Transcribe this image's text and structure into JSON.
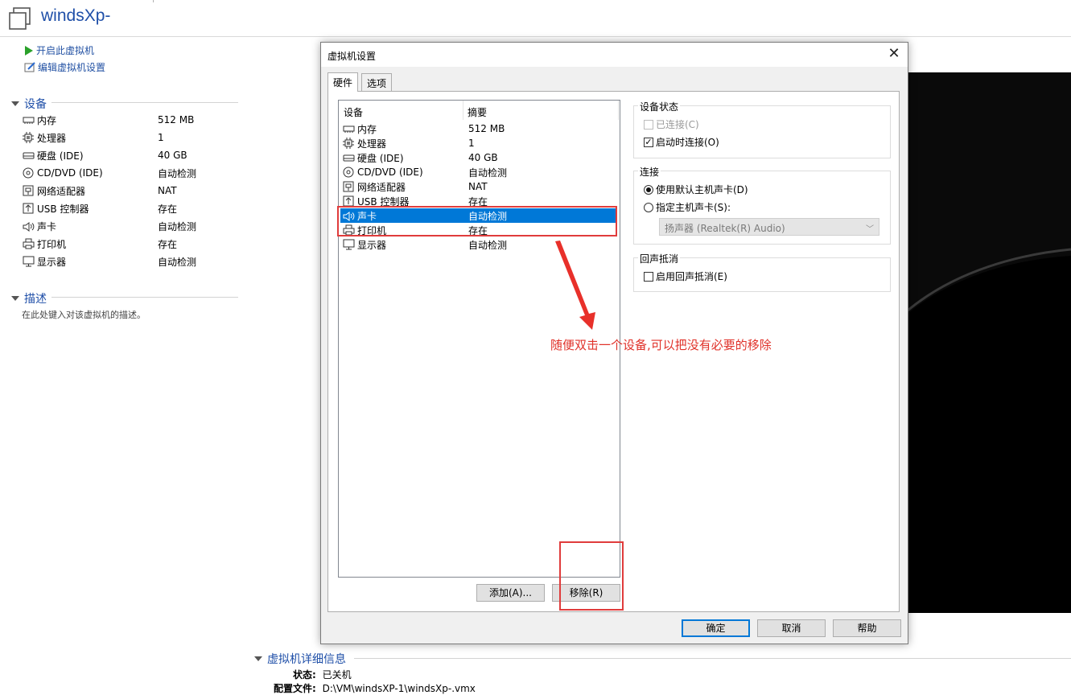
{
  "window": {
    "title": "windsXp-"
  },
  "actions": {
    "power_on": "开启此虚拟机",
    "edit_settings": "编辑虚拟机设置"
  },
  "devices_section": {
    "title": "设备",
    "items": [
      {
        "icon": "memory-icon",
        "name": "内存",
        "value": "512 MB"
      },
      {
        "icon": "cpu-icon",
        "name": "处理器",
        "value": "1"
      },
      {
        "icon": "harddisk-icon",
        "name": "硬盘 (IDE)",
        "value": "40 GB"
      },
      {
        "icon": "cd-icon",
        "name": "CD/DVD (IDE)",
        "value": "自动检测"
      },
      {
        "icon": "network-icon",
        "name": "网络适配器",
        "value": "NAT"
      },
      {
        "icon": "usb-icon",
        "name": "USB 控制器",
        "value": "存在"
      },
      {
        "icon": "speaker-icon",
        "name": "声卡",
        "value": "自动检测"
      },
      {
        "icon": "printer-icon",
        "name": "打印机",
        "value": "存在"
      },
      {
        "icon": "monitor-icon",
        "name": "显示器",
        "value": "自动检测"
      }
    ]
  },
  "description_section": {
    "title": "描述",
    "hint": "在此处键入对该虚拟机的描述。"
  },
  "details_section": {
    "title": "虚拟机详细信息",
    "status_label": "状态:",
    "status_value": "已关机",
    "config_label": "配置文件:",
    "config_value": "D:\\VM\\windsXP-1\\windsXp-.vmx"
  },
  "dialog": {
    "title": "虚拟机设置",
    "close_glyph": "✕",
    "tabs": [
      {
        "label": "硬件",
        "active": true
      },
      {
        "label": "选项",
        "active": false
      }
    ],
    "list_headers": {
      "device": "设备",
      "summary": "摘要"
    },
    "devices": [
      {
        "icon": "memory-icon",
        "name": "内存",
        "summary": "512 MB",
        "selected": false
      },
      {
        "icon": "cpu-icon",
        "name": "处理器",
        "summary": "1",
        "selected": false
      },
      {
        "icon": "harddisk-icon",
        "name": "硬盘 (IDE)",
        "summary": "40 GB",
        "selected": false
      },
      {
        "icon": "cd-icon",
        "name": "CD/DVD (IDE)",
        "summary": "自动检测",
        "selected": false
      },
      {
        "icon": "network-icon",
        "name": "网络适配器",
        "summary": "NAT",
        "selected": false
      },
      {
        "icon": "usb-icon",
        "name": "USB 控制器",
        "summary": "存在",
        "selected": false
      },
      {
        "icon": "speaker-icon",
        "name": "声卡",
        "summary": "自动检测",
        "selected": true
      },
      {
        "icon": "printer-icon",
        "name": "打印机",
        "summary": "存在",
        "selected": false
      },
      {
        "icon": "monitor-icon",
        "name": "显示器",
        "summary": "自动检测",
        "selected": false
      }
    ],
    "add_button": "添加(A)...",
    "remove_button": "移除(R)",
    "device_status": {
      "title": "设备状态",
      "connected": {
        "label": "已连接(C)",
        "checked": false,
        "disabled": true
      },
      "connect_at_power_on": {
        "label": "启动时连接(O)",
        "checked": true,
        "disabled": false
      }
    },
    "connection": {
      "title": "连接",
      "use_default": {
        "label": "使用默认主机声卡(D)",
        "selected": true
      },
      "specify": {
        "label": "指定主机声卡(S):",
        "selected": false
      },
      "sound_card_value": "扬声器 (Realtek(R) Audio)"
    },
    "echo_cancel": {
      "title": "回声抵消",
      "enable": {
        "label": "启用回声抵消(E)",
        "checked": false
      }
    },
    "ok_button": "确定",
    "cancel_button": "取消",
    "help_button": "帮助"
  },
  "annotation": {
    "text": "随便双击一个设备,可以把没有必要的移除",
    "color": "#e0322a"
  },
  "colors": {
    "selection": "#0078d7",
    "link": "#2251a3",
    "section_title": "#1f4fa8"
  }
}
